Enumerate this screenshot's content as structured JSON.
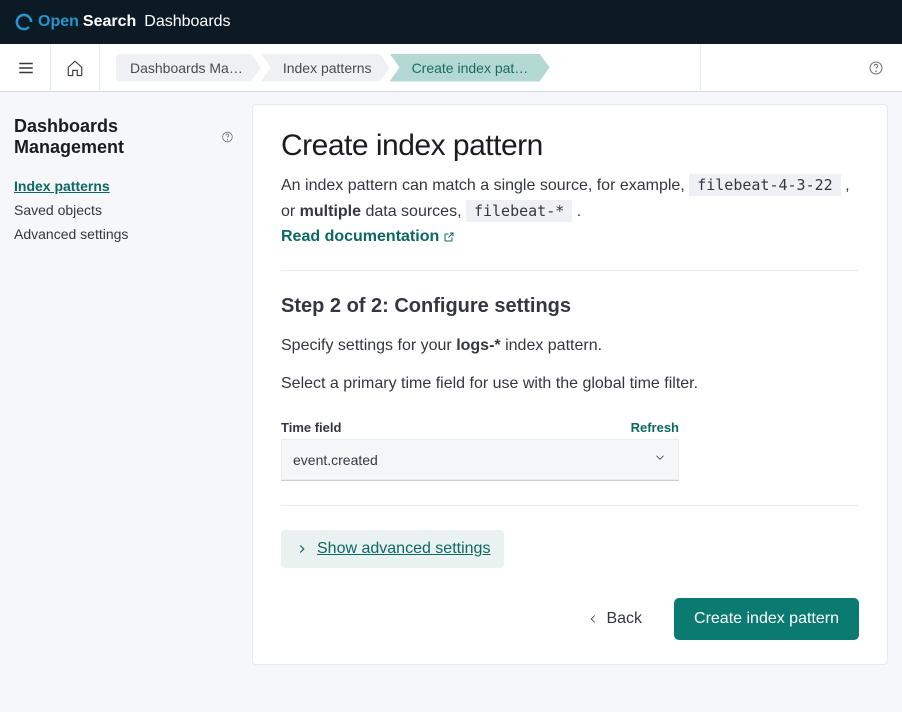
{
  "header": {
    "logo_open": "Open",
    "logo_search": "Search",
    "logo_dash": "Dashboards"
  },
  "breadcrumbs": {
    "item1": "Dashboards Ma…",
    "item2": "Index patterns",
    "item3": "Create index pattern"
  },
  "sidebar": {
    "title": "Dashboards Management",
    "links": {
      "index_patterns": "Index patterns",
      "saved_objects": "Saved objects",
      "advanced_settings": "Advanced settings"
    }
  },
  "main": {
    "title": "Create index pattern",
    "intro_part1": "An index pattern can match a single source, for example, ",
    "intro_code1": "filebeat-4-3-22",
    "intro_part2": " , or ",
    "intro_bold": "multiple",
    "intro_part3": " data sources, ",
    "intro_code2": "filebeat-*",
    "intro_part4": " .",
    "doc_link": "Read documentation",
    "step_title": "Step 2 of 2: Configure settings",
    "step_desc1_a": "Specify settings for your ",
    "step_desc1_b": "logs-*",
    "step_desc1_c": " index pattern.",
    "step_desc2": "Select a primary time field for use with the global time filter.",
    "time_field_label": "Time field",
    "refresh": "Refresh",
    "select_value": "event.created",
    "adv_settings": "Show advanced settings",
    "back": "Back",
    "create": "Create index pattern"
  }
}
